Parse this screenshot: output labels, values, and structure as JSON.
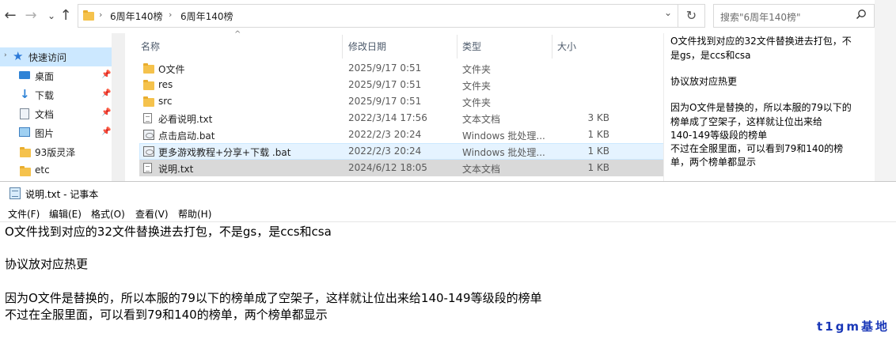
{
  "explorer": {
    "address": {
      "crumbs": [
        "6周年140榜",
        "6周年140榜"
      ],
      "separator": "›",
      "dropdown": "⌄",
      "refresh": "↻"
    },
    "search": {
      "placeholder": "搜索\"6周年140榜\""
    },
    "nav": {
      "back": "←",
      "forward": "→",
      "recent": "⌄",
      "up": "↑",
      "items": [
        {
          "label": "快速访问"
        },
        {
          "label": "桌面"
        },
        {
          "label": "下载"
        },
        {
          "label": "文档"
        },
        {
          "label": "图片"
        },
        {
          "label": "93版灵泽"
        },
        {
          "label": "etc"
        }
      ]
    },
    "columns": {
      "name": "名称",
      "date": "修改日期",
      "type": "类型",
      "size": "大小"
    },
    "files": [
      {
        "name": "O文件",
        "date": "2025/9/17 0:51",
        "type": "文件夹",
        "size": "",
        "icon": "folder-icon"
      },
      {
        "name": "res",
        "date": "2025/9/17 0:51",
        "type": "文件夹",
        "size": "",
        "icon": "folder-icon"
      },
      {
        "name": "src",
        "date": "2025/9/17 0:51",
        "type": "文件夹",
        "size": "",
        "icon": "folder-icon"
      },
      {
        "name": "必看说明.txt",
        "date": "2022/3/14 17:56",
        "type": "文本文档",
        "size": "3 KB",
        "icon": "text-file-icon"
      },
      {
        "name": "点击启动.bat",
        "date": "2022/2/3 20:24",
        "type": "Windows 批处理...",
        "size": "1 KB",
        "icon": "batch-file-icon"
      },
      {
        "name": "更多游戏教程+分享+下载 .bat",
        "date": "2022/2/3 20:24",
        "type": "Windows 批处理...",
        "size": "1 KB",
        "icon": "batch-file-icon"
      },
      {
        "name": "说明.txt",
        "date": "2024/6/12 18:05",
        "type": "文本文档",
        "size": "1 KB",
        "icon": "text-file-icon"
      }
    ],
    "preview": {
      "lines": [
        "O文件找到对应的32文件替换进去打包，不",
        "是gs，是ccs和csa",
        "",
        "协议放对应热更",
        "",
        "因为O文件是替换的，所以本服的79以下的",
        "榜单成了空架子，这样就让位出来给",
        "140-149等级段的榜单",
        "不过在全服里面，可以看到79和140的榜",
        "单，两个榜单都显示"
      ]
    }
  },
  "notepad": {
    "title": "说明.txt - 记事本",
    "menu": [
      "文件(F)",
      "编辑(E)",
      "格式(O)",
      "查看(V)",
      "帮助(H)"
    ],
    "lines": [
      "O文件找到对应的32文件替换进去打包，不是gs，是ccs和csa",
      "",
      "协议放对应热更",
      "",
      "因为O文件是替换的，所以本服的79以下的榜单成了空架子，这样就让位出来给140-149等级段的榜单",
      "不过在全服里面，可以看到79和140的榜单，两个榜单都显示"
    ]
  },
  "watermark": "t1gm基地"
}
